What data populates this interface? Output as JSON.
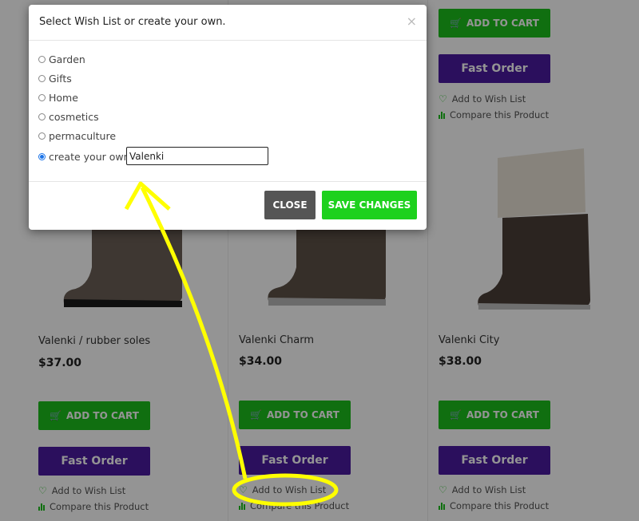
{
  "products": [
    {
      "name": "Valenki / rubber soles",
      "price": "$37.00",
      "add_to_cart": "ADD TO CART",
      "fast_order": "Fast Order",
      "wishlist": "Add to Wish List",
      "compare": "Compare this Product"
    },
    {
      "name": "Valenki Charm",
      "price": "$34.00",
      "add_to_cart": "ADD TO CART",
      "fast_order": "Fast Order",
      "wishlist": "Add to Wish List",
      "compare": "Compare this Product"
    },
    {
      "name": "Valenki City",
      "price": "$38.00",
      "add_to_cart": "ADD TO CART",
      "fast_order": "Fast Order",
      "wishlist": "Add to Wish List",
      "compare": "Compare this Product"
    }
  ],
  "modal": {
    "title": "Select Wish List or create your own.",
    "close_x": "×",
    "options": [
      {
        "label": "Garden",
        "checked": false
      },
      {
        "label": "Gifts",
        "checked": false
      },
      {
        "label": "Home",
        "checked": false
      },
      {
        "label": "cosmetics",
        "checked": false
      },
      {
        "label": "permaculture",
        "checked": false
      },
      {
        "label": "create your own",
        "checked": true
      }
    ],
    "custom_value": "Valenki",
    "close_button": "CLOSE",
    "save_button": "SAVE CHANGES"
  },
  "colors": {
    "cart_green": "#1dbf1d",
    "save_green": "#1dd11d",
    "fast_purple": "#4a1aa0",
    "close_gray": "#555555",
    "annotation_yellow": "#ffff00"
  }
}
